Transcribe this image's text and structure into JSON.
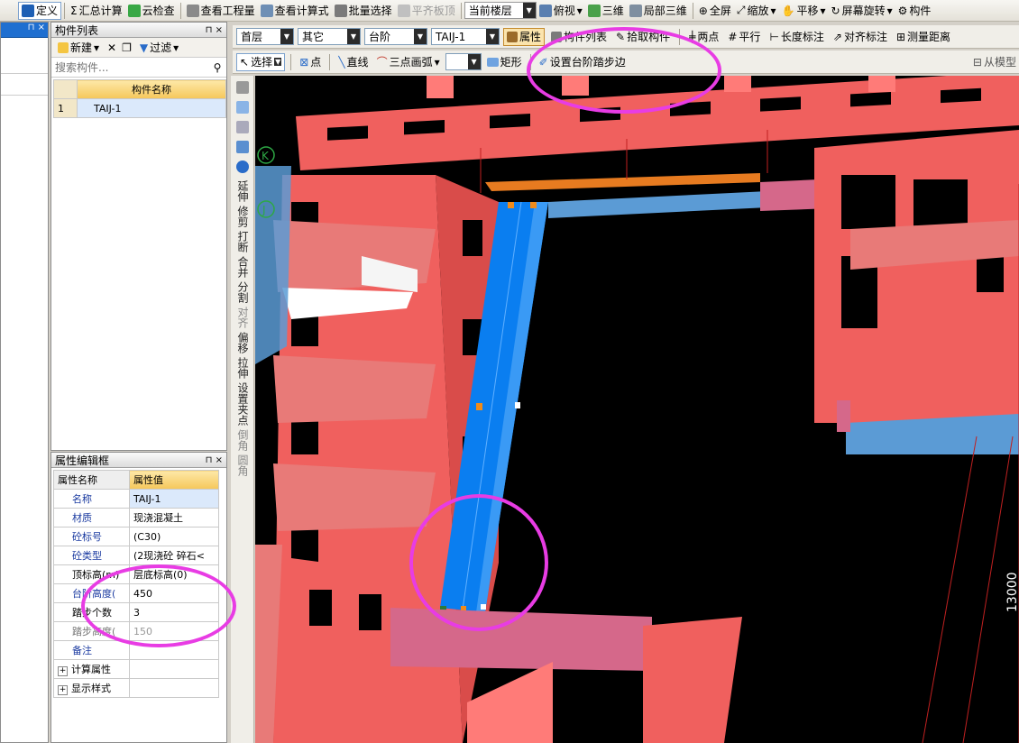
{
  "toolbar1": {
    "items": [
      "定义",
      "汇总计算",
      "云检查",
      "查看工程量",
      "查看计算式",
      "批量选择",
      "平齐板顶"
    ],
    "floor_select": "当前楼层",
    "view_items": [
      "俯视",
      "三维",
      "局部三维",
      "全屏",
      "缩放",
      "平移",
      "屏幕旋转",
      "构件"
    ]
  },
  "toolbar2": {
    "floor": "首层",
    "category": "其它",
    "type": "台阶",
    "component": "TAIJ-1",
    "attr_btn": "属性",
    "list_btn": "构件列表",
    "pick_btn": "拾取构件",
    "tools": [
      "两点",
      "平行",
      "长度标注",
      "对齐标注",
      "测量距离"
    ]
  },
  "toolbar3": {
    "select": "选择",
    "point": "点",
    "line": "直线",
    "arc": "三点画弧",
    "rect": "矩形",
    "set_step": "设置台阶踏步边",
    "from_model": "从模型"
  },
  "component_list": {
    "title": "构件列表",
    "new": "新建",
    "filter": "过滤",
    "search_placeholder": "搜索构件...",
    "col_header": "构件名称",
    "rows": [
      {
        "index": "1",
        "name": "TAIJ-1"
      }
    ]
  },
  "property_editor": {
    "title": "属性编辑框",
    "col_name": "属性名称",
    "col_value": "属性值",
    "rows": [
      {
        "name": "名称",
        "value": "TAIJ-1"
      },
      {
        "name": "材质",
        "value": "现浇混凝土"
      },
      {
        "name": "砼标号",
        "value": "(C30)"
      },
      {
        "name": "砼类型",
        "value": "(2现浇砼  碎石<"
      },
      {
        "name": "顶标高(m)",
        "value": "层底标高(0)"
      },
      {
        "name": "台阶高度(",
        "value": "450"
      },
      {
        "name": "踏步个数",
        "value": "3"
      },
      {
        "name": "踏步高度(",
        "value": "150"
      },
      {
        "name": "备注",
        "value": ""
      },
      {
        "name": "计算属性",
        "value": ""
      },
      {
        "name": "显示样式",
        "value": ""
      }
    ]
  },
  "side_tools": [
    "延伸",
    "修剪",
    "打断",
    "合并",
    "分割",
    "对齐",
    "偏移",
    "拉伸",
    "设置夹点",
    "倒角",
    "圆角"
  ],
  "canvas": {
    "axis_labels": [
      "K",
      "J"
    ],
    "dimension": "13000"
  },
  "colors": {
    "wall": "#f0605e",
    "stair": "#0a7ef0",
    "highlight": "#e83ce4",
    "slab": "#5b9bd5"
  }
}
